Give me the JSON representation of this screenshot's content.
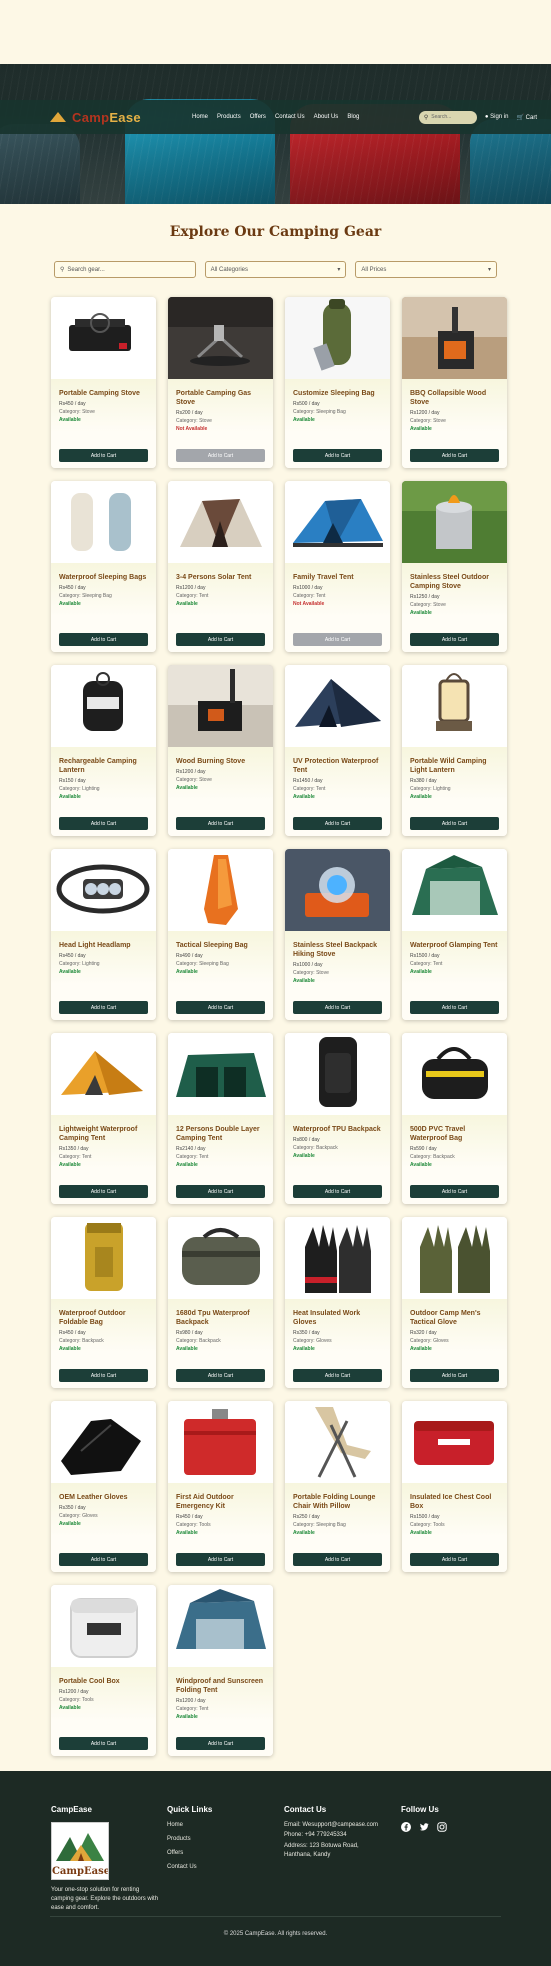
{
  "nav": {
    "logo_camp": "Camp",
    "logo_ease": "Ease",
    "links": [
      "Home",
      "Products",
      "Offers",
      "Contact Us",
      "About Us",
      "Blog"
    ],
    "search_placeholder": "Search...",
    "sign_in": "Sign in",
    "cart": "Cart"
  },
  "page": {
    "title": "Explore Our Camping Gear"
  },
  "filters": {
    "search_placeholder": "Search gear...",
    "category": "All Categories",
    "price": "All Prices"
  },
  "products": [
    {
      "name": "Portable Camping Stove",
      "price": "Rs450 / day",
      "category": "Category: Stove",
      "availability": "Available",
      "available": true,
      "button": "Add to Cart",
      "icon": "camping-stove"
    },
    {
      "name": "Portable Camping Gas Stove",
      "price": "Rs200 / day",
      "category": "Category: Stove",
      "availability": "Not Available",
      "available": false,
      "button": "Add to Cart",
      "icon": "gas-stove"
    },
    {
      "name": "Customize Sleeping Bag",
      "price": "Rs500 / day",
      "category": "Category: Sleeping Bag",
      "availability": "Available",
      "available": true,
      "button": "Add to Cart",
      "icon": "sleeping-bag"
    },
    {
      "name": "BBQ Collapsible Wood Stove",
      "price": "Rs1200 / day",
      "category": "Category: Stove",
      "availability": "Available",
      "available": true,
      "button": "Add to Cart",
      "icon": "wood-stove"
    },
    {
      "name": "Waterproof Sleeping Bags",
      "price": "Rs450 / day",
      "category": "Category: Sleeping Bag",
      "availability": "Available",
      "available": true,
      "button": "Add to Cart",
      "icon": "sleeping-bags"
    },
    {
      "name": "3-4 Persons Solar Tent",
      "price": "Rs1200 / day",
      "category": "Category: Tent",
      "availability": "Available",
      "available": true,
      "button": "Add to Cart",
      "icon": "solar-tent"
    },
    {
      "name": "Family Travel Tent",
      "price": "Rs1000 / day",
      "category": "Category: Tent",
      "availability": "Not Available",
      "available": false,
      "button": "Add to Cart",
      "icon": "family-tent"
    },
    {
      "name": "Stainless Steel Outdoor Camping Stove",
      "price": "Rs1250 / day",
      "category": "Category: Stove",
      "availability": "Available",
      "available": true,
      "button": "Add to Cart",
      "icon": "steel-stove"
    },
    {
      "name": "Rechargeable Camping Lantern",
      "price": "Rs150 / day",
      "category": "Category: Lighting",
      "availability": "Available",
      "available": true,
      "button": "Add to Cart",
      "icon": "lantern"
    },
    {
      "name": "Wood Burning Stove",
      "price": "Rs1200 / day",
      "category": "Category: Stove",
      "availability": "Available",
      "available": true,
      "button": "Add to Cart",
      "icon": "burning-stove"
    },
    {
      "name": "UV Protection Waterproof Tent",
      "price": "Rs1450 / day",
      "category": "Category: Tent",
      "availability": "Available",
      "available": true,
      "button": "Add to Cart",
      "icon": "uv-tent"
    },
    {
      "name": "Portable Wild Camping Light Lantern",
      "price": "Rs380 / day",
      "category": "Category: Lighting",
      "availability": "Available",
      "available": true,
      "button": "Add to Cart",
      "icon": "wild-lantern"
    },
    {
      "name": "Head Light Headlamp",
      "price": "Rs450 / day",
      "category": "Category: Lighting",
      "availability": "Available",
      "available": true,
      "button": "Add to Cart",
      "icon": "headlamp"
    },
    {
      "name": "Tactical Sleeping Bag",
      "price": "Rs490 / day",
      "category": "Category: Sleeping Bag",
      "availability": "Available",
      "available": true,
      "button": "Add to Cart",
      "icon": "tactical-bag"
    },
    {
      "name": "Stainless Steel Backpack Hiking Stove",
      "price": "Rs1000 / day",
      "category": "Category: Stove",
      "availability": "Available",
      "available": true,
      "button": "Add to Cart",
      "icon": "hiking-stove"
    },
    {
      "name": "Waterproof Glamping Tent",
      "price": "Rs1500 / day",
      "category": "Category: Tent",
      "availability": "Available",
      "available": true,
      "button": "Add to Cart",
      "icon": "glamping-tent"
    },
    {
      "name": "Lightweight Waterproof Camping Tent",
      "price": "Rs1350 / day",
      "category": "Category: Tent",
      "availability": "Available",
      "available": true,
      "button": "Add to Cart",
      "icon": "light-tent"
    },
    {
      "name": "12 Persons Double Layer Camping Tent",
      "price": "Rs2140 / day",
      "category": "Category: Tent",
      "availability": "Available",
      "available": true,
      "button": "Add to Cart",
      "icon": "big-tent"
    },
    {
      "name": "Waterproof TPU Backpack",
      "price": "Rs800 / day",
      "category": "Category: Backpack",
      "availability": "Available",
      "available": true,
      "button": "Add to Cart",
      "icon": "tpu-backpack"
    },
    {
      "name": "500D PVC Travel Waterproof Bag",
      "price": "Rs590 / day",
      "category": "Category: Backpack",
      "availability": "Available",
      "available": true,
      "button": "Add to Cart",
      "icon": "pvc-bag"
    },
    {
      "name": "Waterproof Outdoor Foldable Bag",
      "price": "Rs450 / day",
      "category": "Category: Backpack",
      "availability": "Available",
      "available": true,
      "button": "Add to Cart",
      "icon": "foldable-bag"
    },
    {
      "name": "1680d Tpu Waterproof Backpack",
      "price": "Rs980 / day",
      "category": "Category: Backpack",
      "availability": "Available",
      "available": true,
      "button": "Add to Cart",
      "icon": "duffel-bag"
    },
    {
      "name": "Heat Insulated Work Gloves",
      "price": "Rs350 / day",
      "category": "Category: Gloves",
      "availability": "Available",
      "available": true,
      "button": "Add to Cart",
      "icon": "work-gloves"
    },
    {
      "name": "Outdoor Camp Men's Tactical Glove",
      "price": "Rs320 / day",
      "category": "Category: Gloves",
      "availability": "Available",
      "available": true,
      "button": "Add to Cart",
      "icon": "tactical-gloves"
    },
    {
      "name": "OEM Leather Gloves",
      "price": "Rs350 / day",
      "category": "Category: Gloves",
      "availability": "Available",
      "available": true,
      "button": "Add to Cart",
      "icon": "leather-gloves"
    },
    {
      "name": "First Aid Outdoor Emergency Kit",
      "price": "Rs450 / day",
      "category": "Category: Tools",
      "availability": "Available",
      "available": true,
      "button": "Add to Cart",
      "icon": "first-aid"
    },
    {
      "name": "Portable Folding Lounge Chair With Pillow",
      "price": "Rs250 / day",
      "category": "Category: Sleeping Bag",
      "availability": "Available",
      "available": true,
      "button": "Add to Cart",
      "icon": "lounge-chair"
    },
    {
      "name": "Insulated Ice Chest Cool Box",
      "price": "Rs1500 / day",
      "category": "Category: Tools",
      "availability": "Available",
      "available": true,
      "button": "Add to Cart",
      "icon": "ice-chest"
    },
    {
      "name": "Portable Cool Box",
      "price": "Rs1200 / day",
      "category": "Category: Tools",
      "availability": "Available",
      "available": true,
      "button": "Add to Cart",
      "icon": "cool-box"
    },
    {
      "name": "Windproof and Sunscreen Folding Tent",
      "price": "Rs1200 / day",
      "category": "Category: Tent",
      "availability": "Available",
      "available": true,
      "button": "Add to Cart",
      "icon": "folding-tent"
    }
  ],
  "footer": {
    "brand_title": "CampEase",
    "logo_text": "CampEase",
    "tagline": "Your one-stop solution for renting camping gear. Explore the outdoors with ease and comfort.",
    "quick_links_title": "Quick Links",
    "quick_links": [
      "Home",
      "Products",
      "Offers",
      "Contact Us"
    ],
    "contact_title": "Contact Us",
    "email": "Email: Wesupport@campease.com",
    "phone": "Phone: +94 779245334",
    "address": "Address: 123 Botuwa Road, Hanthana, Kandy",
    "follow_title": "Follow Us",
    "social_icons": [
      "facebook-icon",
      "twitter-icon",
      "instagram-icon"
    ],
    "copyright": "© 2025 CampEase. All rights reserved."
  }
}
